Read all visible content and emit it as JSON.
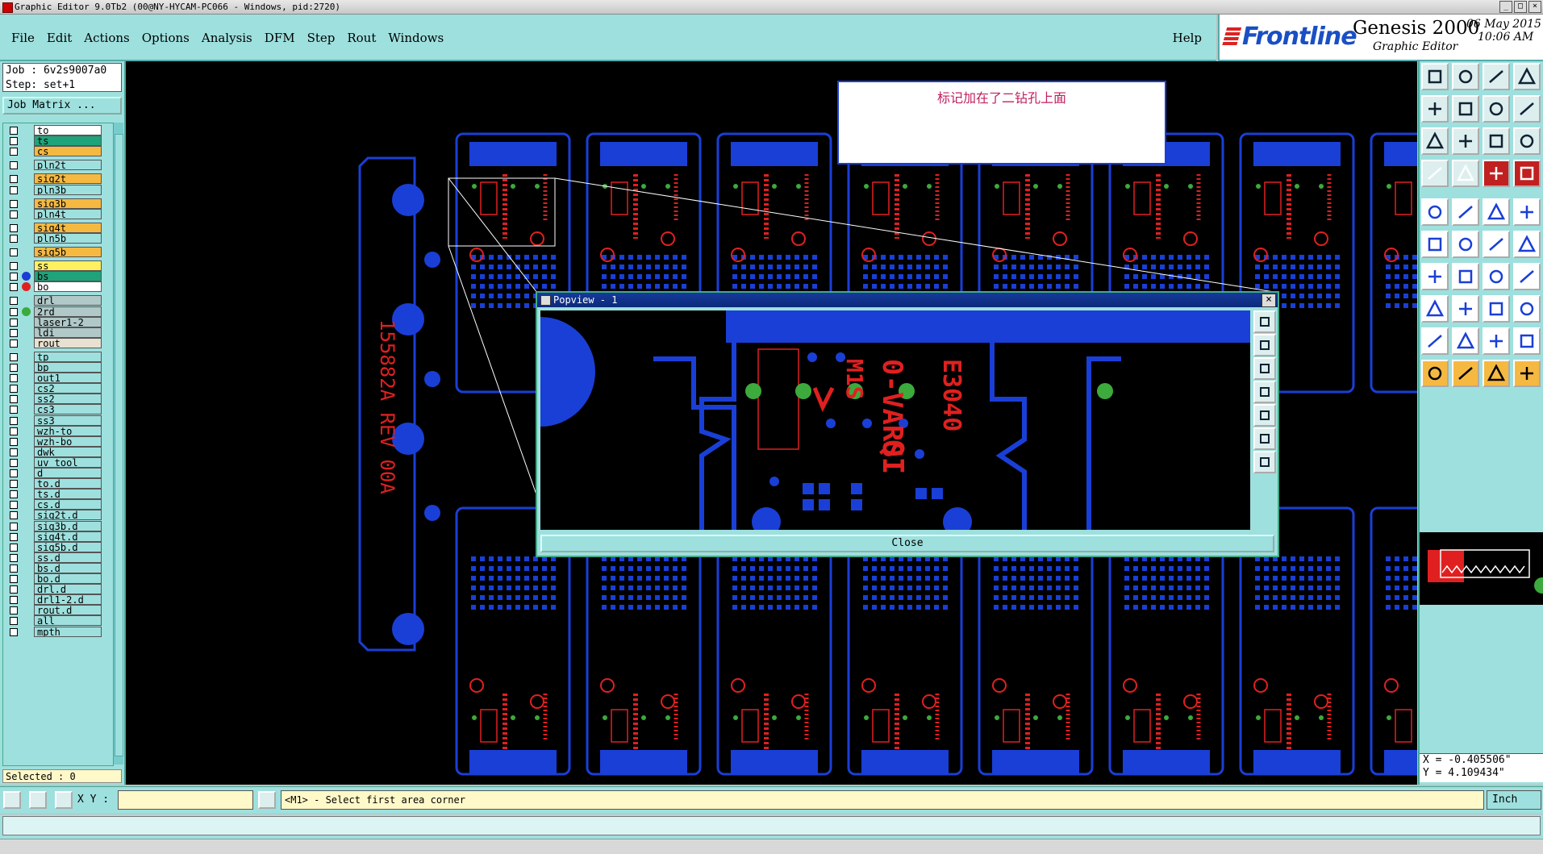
{
  "window": {
    "title": "Graphic Editor 9.0Tb2 (00@NY-HYCAM-PC066 - Windows, pid:2720)"
  },
  "menu": {
    "items": [
      "File",
      "Edit",
      "Actions",
      "Options",
      "Analysis",
      "DFM",
      "Step",
      "Rout",
      "Windows"
    ],
    "help": "Help"
  },
  "brand": {
    "logo": "Frontline",
    "product": "Genesis 2000",
    "subtitle": "Graphic Editor",
    "date": "06 May 2015",
    "time": "10:06 AM"
  },
  "job": {
    "job_line": "Job : 6v2s9007a0",
    "step_line": "Step: set+1",
    "matrix_button": "Job Matrix ..."
  },
  "layers": [
    {
      "name": "to",
      "color": "#ffffff",
      "dot": ""
    },
    {
      "name": "ts",
      "color": "#1fa37a",
      "dot": ""
    },
    {
      "name": "cs",
      "color": "#f5b942",
      "dot": ""
    },
    {
      "name": "pln2t",
      "color": "#9ee0de",
      "dot": ""
    },
    {
      "name": "sig2t",
      "color": "#f5b942",
      "dot": ""
    },
    {
      "name": "pln3b",
      "color": "#9ee0de",
      "dot": ""
    },
    {
      "name": "sig3b",
      "color": "#f5b942",
      "dot": ""
    },
    {
      "name": "pln4t",
      "color": "#9ee0de",
      "dot": ""
    },
    {
      "name": "sig4t",
      "color": "#f5b942",
      "dot": ""
    },
    {
      "name": "pln5b",
      "color": "#9ee0de",
      "dot": ""
    },
    {
      "name": "sig5b",
      "color": "#f5b942",
      "dot": ""
    },
    {
      "name": "ss",
      "color": "#fff060",
      "dot": ""
    },
    {
      "name": "bs",
      "color": "#1fa37a",
      "dot": "#1a3fd6"
    },
    {
      "name": "bo",
      "color": "#ffffff",
      "dot": "#e02020"
    },
    {
      "name": "drl",
      "color": "#b0c8c8",
      "dot": ""
    },
    {
      "name": "2rd",
      "color": "#b0c8c8",
      "dot": "#3caa3c"
    },
    {
      "name": "laser1-2",
      "color": "#b0c8c8",
      "dot": ""
    },
    {
      "name": "ldi",
      "color": "#b0c8c8",
      "dot": ""
    },
    {
      "name": "rout",
      "color": "#e8e0d0",
      "dot": ""
    },
    {
      "name": "tp",
      "color": "#9ee0de",
      "dot": ""
    },
    {
      "name": "bp",
      "color": "#9ee0de",
      "dot": ""
    },
    {
      "name": "out1",
      "color": "#9ee0de",
      "dot": ""
    },
    {
      "name": "cs2",
      "color": "#9ee0de",
      "dot": ""
    },
    {
      "name": "ss2",
      "color": "#9ee0de",
      "dot": ""
    },
    {
      "name": "cs3",
      "color": "#9ee0de",
      "dot": ""
    },
    {
      "name": "ss3",
      "color": "#9ee0de",
      "dot": ""
    },
    {
      "name": "wzh-to",
      "color": "#9ee0de",
      "dot": ""
    },
    {
      "name": "wzh-bo",
      "color": "#9ee0de",
      "dot": ""
    },
    {
      "name": "dwk",
      "color": "#9ee0de",
      "dot": ""
    },
    {
      "name": "uv_tool",
      "color": "#9ee0de",
      "dot": ""
    },
    {
      "name": "d",
      "color": "#9ee0de",
      "dot": ""
    },
    {
      "name": "to.d",
      "color": "#9ee0de",
      "dot": ""
    },
    {
      "name": "ts.d",
      "color": "#9ee0de",
      "dot": ""
    },
    {
      "name": "cs.d",
      "color": "#9ee0de",
      "dot": ""
    },
    {
      "name": "sig2t.d",
      "color": "#9ee0de",
      "dot": ""
    },
    {
      "name": "sig3b.d",
      "color": "#9ee0de",
      "dot": ""
    },
    {
      "name": "sig4t.d",
      "color": "#9ee0de",
      "dot": ""
    },
    {
      "name": "sig5b.d",
      "color": "#9ee0de",
      "dot": ""
    },
    {
      "name": "ss.d",
      "color": "#9ee0de",
      "dot": ""
    },
    {
      "name": "bs.d",
      "color": "#9ee0de",
      "dot": ""
    },
    {
      "name": "bo.d",
      "color": "#9ee0de",
      "dot": ""
    },
    {
      "name": "drl.d",
      "color": "#9ee0de",
      "dot": ""
    },
    {
      "name": "drl1-2.d",
      "color": "#9ee0de",
      "dot": ""
    },
    {
      "name": "rout.d",
      "color": "#9ee0de",
      "dot": ""
    },
    {
      "name": "all",
      "color": "#9ee0de",
      "dot": ""
    },
    {
      "name": "mpth",
      "color": "#9ee0de",
      "dot": ""
    }
  ],
  "selected": "Selected : 0",
  "note": {
    "text": "标记加在了二钻孔上面"
  },
  "board_text": {
    "rev": "155882A REV 00A"
  },
  "popview": {
    "title": "Popview - 1",
    "close_label": "Close",
    "board_texts": [
      "0-VARS",
      "M1S",
      "E3040",
      "QI"
    ]
  },
  "coords": {
    "x": "X = -0.405506\"",
    "y": "Y = 4.109434\""
  },
  "status": {
    "xy_label": "X Y :",
    "xy_value": "",
    "prompt": "<M1> - Select first area corner",
    "units": "Inch"
  },
  "colors": {
    "panel": "#9ee0de",
    "copper": "#1a3fd6",
    "silk": "#e02020",
    "drill": "#3caa3c"
  }
}
